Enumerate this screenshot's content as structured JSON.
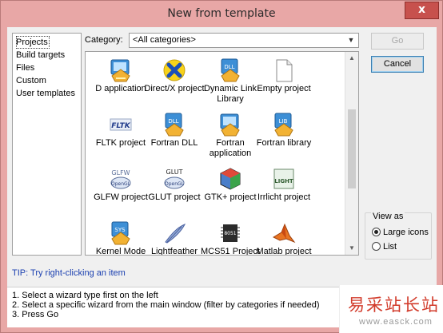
{
  "window": {
    "title": "New from template",
    "close_label": "x"
  },
  "left_list": [
    "Projects",
    "Build targets",
    "Files",
    "Custom",
    "User templates"
  ],
  "category": {
    "label": "Category:",
    "value": "<All categories>"
  },
  "buttons": {
    "go": "Go",
    "cancel": "Cancel"
  },
  "templates": [
    {
      "label": "D application",
      "icon": "d-app-icon"
    },
    {
      "label": "Direct/X project",
      "icon": "directx-icon"
    },
    {
      "label": "Dynamic Link Library",
      "icon": "dll-icon"
    },
    {
      "label": "Empty project",
      "icon": "empty-file-icon"
    },
    {
      "label": "FLTK project",
      "icon": "fltk-icon"
    },
    {
      "label": "Fortran DLL",
      "icon": "fortran-dll-icon"
    },
    {
      "label": "Fortran application",
      "icon": "fortran-app-icon"
    },
    {
      "label": "Fortran library",
      "icon": "fortran-lib-icon"
    },
    {
      "label": "GLFW project",
      "icon": "glfw-icon"
    },
    {
      "label": "GLUT project",
      "icon": "glut-icon"
    },
    {
      "label": "GTK+ project",
      "icon": "gtk-icon"
    },
    {
      "label": "Irrlicht project",
      "icon": "irrlicht-icon"
    },
    {
      "label": "Kernel Mode Driver",
      "icon": "kernel-driver-icon"
    },
    {
      "label": "Lightfeather project",
      "icon": "lightfeather-icon"
    },
    {
      "label": "MCS51 Project",
      "icon": "mcs51-chip-icon"
    },
    {
      "label": "Matlab project",
      "icon": "matlab-icon"
    }
  ],
  "icon_texts": {
    "dll": "DLL",
    "lib": "LIB",
    "fltk": "FLTK",
    "glfw": "GLFW",
    "glut": "GLUT",
    "irr": "LIGHT",
    "sys": "SYS",
    "chip": "8051",
    "gl": "OpenGL"
  },
  "view_as": {
    "legend": "View as",
    "options": [
      "Large icons",
      "List"
    ],
    "selected": "Large icons"
  },
  "tip": "TIP: Try right-clicking an item",
  "steps": [
    "1. Select a wizard type first on the left",
    "2. Select a specific wizard from the main window (filter by categories if needed)",
    "3. Press Go"
  ],
  "watermark": {
    "line1": "易采站长站",
    "line2": "www.easck.com"
  },
  "colors": {
    "title_bar": "#e8a7a6",
    "close_button": "#c7514d",
    "tip_text": "#1a3fb0",
    "watermark": "#d23b2b"
  }
}
